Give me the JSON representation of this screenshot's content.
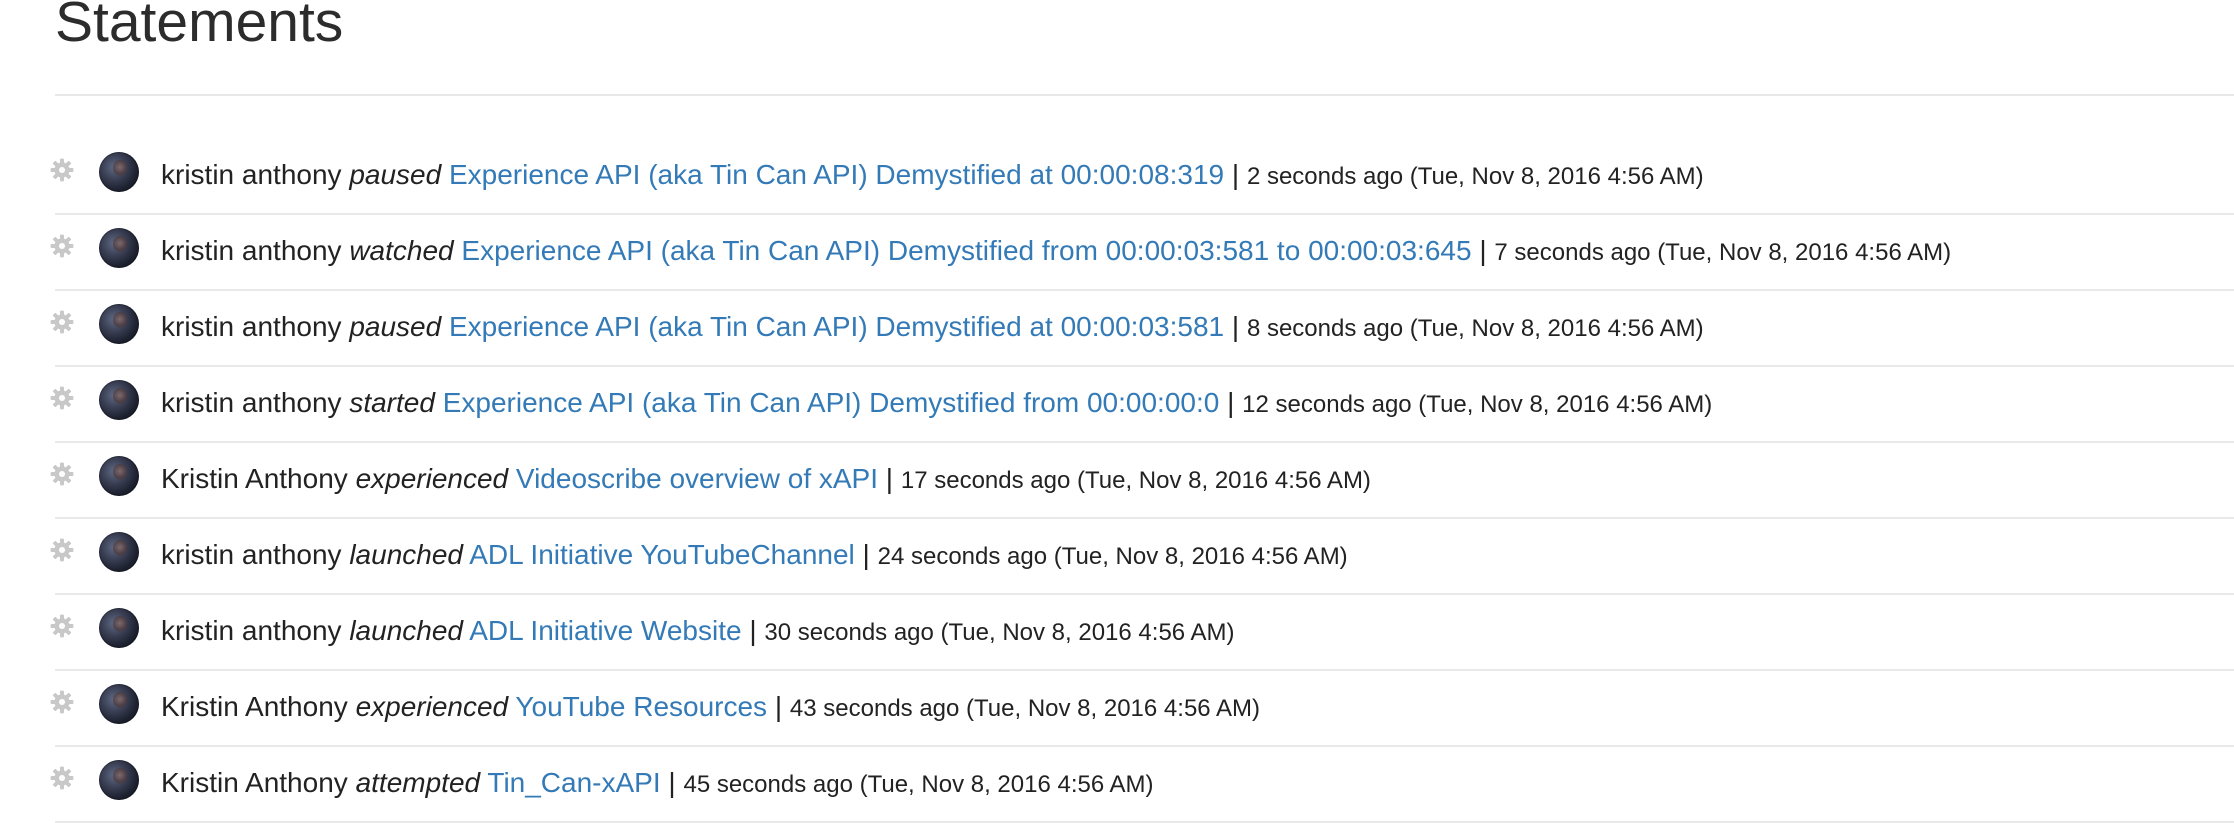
{
  "header": {
    "title": "Statements"
  },
  "icons": {
    "settings": "gear-icon",
    "avatar": "user-avatar"
  },
  "colors": {
    "link": "#337ab7",
    "text": "#222222",
    "divider": "#e9e9e9",
    "gear": "#c8c8c8"
  },
  "statements": [
    {
      "actor": "kristin anthony",
      "verb": "paused",
      "activity": "Experience API (aka Tin Can API) Demystified at 00:00:08:319",
      "separator": "|",
      "time": "2 seconds ago (Tue, Nov 8, 2016 4:56 AM)"
    },
    {
      "actor": "kristin anthony",
      "verb": "watched",
      "activity": "Experience API (aka Tin Can API) Demystified from 00:00:03:581 to 00:00:03:645",
      "separator": "|",
      "time": "7 seconds ago (Tue, Nov 8, 2016 4:56 AM)"
    },
    {
      "actor": "kristin anthony",
      "verb": "paused",
      "activity": "Experience API (aka Tin Can API) Demystified at 00:00:03:581",
      "separator": "|",
      "time": "8 seconds ago (Tue, Nov 8, 2016 4:56 AM)"
    },
    {
      "actor": "kristin anthony",
      "verb": "started",
      "activity": "Experience API (aka Tin Can API) Demystified from 00:00:00:0",
      "separator": "|",
      "time": "12 seconds ago (Tue, Nov 8, 2016 4:56 AM)"
    },
    {
      "actor": "Kristin Anthony",
      "verb": "experienced",
      "activity": "Videoscribe overview of xAPI",
      "separator": "|",
      "time": "17 seconds ago (Tue, Nov 8, 2016 4:56 AM)"
    },
    {
      "actor": "kristin anthony",
      "verb": "launched",
      "activity": "ADL Initiative YouTubeChannel",
      "separator": "|",
      "time": "24 seconds ago (Tue, Nov 8, 2016 4:56 AM)"
    },
    {
      "actor": "kristin anthony",
      "verb": "launched",
      "activity": "ADL Initiative Website",
      "separator": "|",
      "time": "30 seconds ago (Tue, Nov 8, 2016 4:56 AM)"
    },
    {
      "actor": "Kristin Anthony",
      "verb": "experienced",
      "activity": "YouTube Resources",
      "separator": "|",
      "time": "43 seconds ago (Tue, Nov 8, 2016 4:56 AM)"
    },
    {
      "actor": "Kristin Anthony",
      "verb": "attempted",
      "activity": "Tin_Can-xAPI",
      "separator": "|",
      "time": "45 seconds ago (Tue, Nov 8, 2016 4:56 AM)"
    }
  ]
}
